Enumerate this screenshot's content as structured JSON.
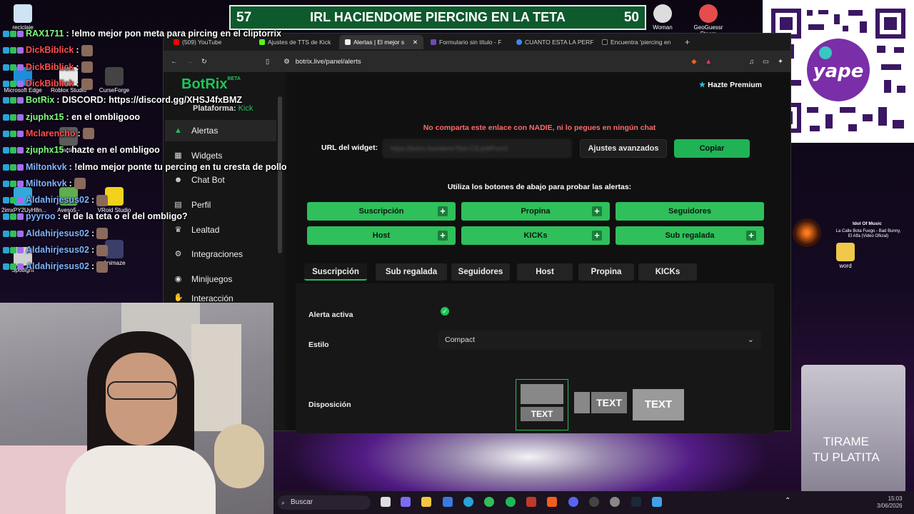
{
  "banner": {
    "left": "57",
    "title": "IRL HACIENDOME PIERCING EN LA TETA",
    "right": "50"
  },
  "desktop": {
    "icons": [
      {
        "label": "reciclaje"
      },
      {
        "label": "Microsoft Edge"
      },
      {
        "label": "Roblox Studio"
      },
      {
        "label": "CurseForge"
      },
      {
        "label": "Tactics"
      },
      {
        "label": "2imxPY2UyH8n..."
      },
      {
        "label": "Aveso5 -"
      },
      {
        "label": "VRoid Studio"
      },
      {
        "label": "Spotlight"
      },
      {
        "label": "Animaze"
      },
      {
        "label": "word"
      },
      {
        "label": "Woman"
      },
      {
        "label": "GeoGuessr Steam"
      }
    ],
    "widget_title": "Idol Of Music",
    "widget_song": "La Calle Bota Fuego - Bad Bunny, El Alfa (Video Oficial)",
    "glass_text_1": "TIRAME",
    "glass_text_2": "TU PLATITA",
    "time": "15:03",
    "date": "3/06/2026"
  },
  "chat": [
    {
      "user": "RAX1711",
      "text": ": !elmo mejor pon meta para pircing en el cliptorrix",
      "color": "#7cff7c"
    },
    {
      "user": "DickBiblick",
      "text": ":",
      "color": "#ff4f4f"
    },
    {
      "user": "DickBiblick",
      "text": ":",
      "color": "#ff4f4f"
    },
    {
      "user": "DickBiblick",
      "text": ":",
      "color": "#ff4f4f"
    },
    {
      "user": "BotRix",
      "text": ": DISCORD: https://discord.gg/XHSJ4fxBMZ",
      "color": "#7cff7c"
    },
    {
      "user": "zjuphx15",
      "text": ": en el ombligooo",
      "color": "#7cff7c"
    },
    {
      "user": "Mclarencho",
      "text": ":",
      "color": "#ff4f4f"
    },
    {
      "user": "zjuphx15",
      "text": ": hazte en el ombligoo",
      "color": "#7cff7c"
    },
    {
      "user": "Miltonkvk",
      "text": ": !elmo mejor ponte tu percing en tu cresta de pollo",
      "color": "#7fb3ff"
    },
    {
      "user": "Miltonkvk",
      "text": ":",
      "color": "#7fb3ff"
    },
    {
      "user": "Aldahirjesus02",
      "text": ":",
      "color": "#7fb3ff"
    },
    {
      "user": "pyyroo",
      "text": ": el de la teta o el del ombligo?",
      "color": "#7fb3ff"
    },
    {
      "user": "Aldahirjesus02",
      "text": ":",
      "color": "#7fb3ff"
    },
    {
      "user": "Aldahirjesus02",
      "text": ":",
      "color": "#7fb3ff"
    },
    {
      "user": "Aldahirjesus02",
      "text": ":",
      "color": "#7fb3ff"
    }
  ],
  "browser": {
    "tabs": [
      {
        "label": "(509) YouTube"
      },
      {
        "label": "Ajustes de TTS de Kick"
      },
      {
        "label": "Alertas | El mejor s"
      },
      {
        "label": "Formulario sin título - F"
      },
      {
        "label": "CUANTO ESTA LA PERF"
      },
      {
        "label": "Encuentra 'piercing en"
      }
    ],
    "url": "botrix.live/panel/alerts"
  },
  "sidebar": {
    "logo": "BotRix",
    "beta": "BETA",
    "platform_label": "Plataforma:",
    "platform": "Kick",
    "items": [
      {
        "label": "Alertas"
      },
      {
        "label": "Widgets"
      },
      {
        "label": "Chat Bot"
      },
      {
        "label": "Perfil"
      },
      {
        "label": "Lealtad"
      },
      {
        "label": "Integraciones"
      },
      {
        "label": "Minijuegos"
      },
      {
        "label": "Interacción"
      }
    ]
  },
  "main": {
    "premium": "Hazte Premium",
    "warning": "No comparta este enlace con NADIE, ni lo pegues en ningún chat",
    "widget_url_label": "URL del widget:",
    "widget_url_value": "https://botrix.live/alerts?bid=ClLtpMPumV",
    "advanced": "Ajustes avanzados",
    "copy": "Copiar",
    "instructions": "Utiliza los botones de abajo para probar las alertas:",
    "test_buttons": [
      {
        "label": "Suscripción",
        "plus": "+"
      },
      {
        "label": "Propina",
        "plus": "+"
      },
      {
        "label": "Seguidores",
        "plus": ""
      },
      {
        "label": "Host",
        "plus": "+"
      },
      {
        "label": "KICKs",
        "plus": "+"
      },
      {
        "label": "Sub regalada",
        "plus": "+"
      }
    ],
    "settings_tabs": [
      {
        "label": "Suscripción"
      },
      {
        "label": "Sub regalada"
      },
      {
        "label": "Seguidores"
      },
      {
        "label": "Host"
      },
      {
        "label": "Propina"
      },
      {
        "label": "KICKs"
      }
    ],
    "alert_active_label": "Alerta activa",
    "style_label": "Estilo",
    "style_value": "Compact",
    "layout_label": "Disposición",
    "layout_text": "TEXT"
  },
  "taskbar": {
    "search": "Buscar"
  }
}
